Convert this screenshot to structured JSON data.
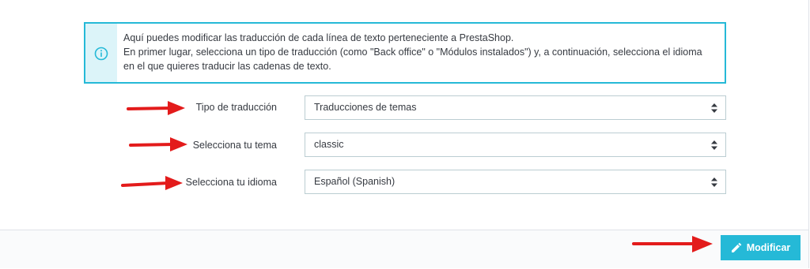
{
  "alert": {
    "icon": "info-icon",
    "lines": [
      "Aquí puedes modificar las traducción de cada línea de texto perteneciente a PrestaShop.",
      "En primer lugar, selecciona un tipo de traducción (como \"Back office\" o \"Módulos instalados\") y, a continuación, selecciona el idioma",
      "en el que quieres traducir las cadenas de texto."
    ],
    "accent_color": "#25b9d7"
  },
  "form": {
    "fields": [
      {
        "label": "Tipo de traducción",
        "value": "Traducciones de temas"
      },
      {
        "label": "Selecciona tu tema",
        "value": "classic"
      },
      {
        "label": "Selecciona tu idioma",
        "value": "Español (Spanish)"
      }
    ]
  },
  "footer": {
    "submit_label": "Modificar",
    "submit_icon": "pencil-icon",
    "button_color": "#25b9d7"
  },
  "annotations": {
    "arrow_color": "#e31b1b"
  }
}
